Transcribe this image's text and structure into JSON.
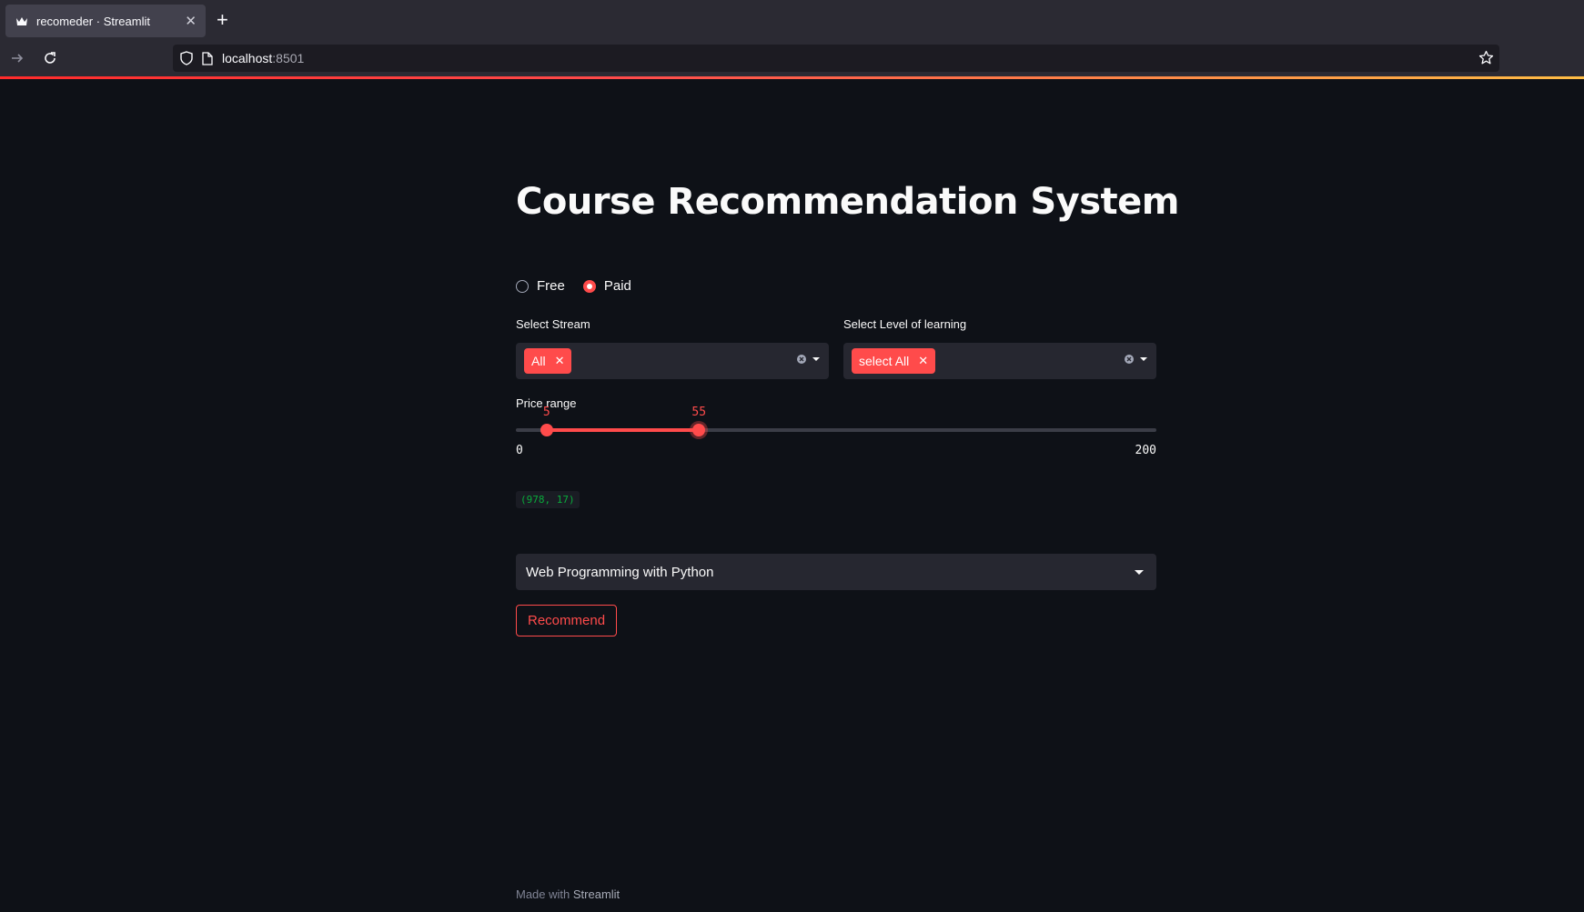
{
  "browser": {
    "tab_title": "recomeder · Streamlit",
    "url_host": "localhost",
    "url_port": ":8501",
    "icons": [
      "streamlit-crown-icon",
      "close-icon",
      "plus-icon",
      "forward-icon",
      "reload-icon",
      "shield-icon",
      "page-icon",
      "star-icon"
    ]
  },
  "app": {
    "title": "Course Recommendation System",
    "price_type": {
      "options": [
        "Free",
        "Paid"
      ],
      "selected": "Paid"
    },
    "stream": {
      "label": "Select Stream",
      "chips": [
        "All"
      ]
    },
    "level": {
      "label": "Select Level of learning",
      "chips": [
        "select All"
      ]
    },
    "price_range": {
      "label": "Price range",
      "min": 0,
      "max": 200,
      "low": 5,
      "high": 55,
      "min_label": "0",
      "max_label": "200",
      "low_label": "5",
      "high_label": "55"
    },
    "output_text": "(978, 17)",
    "course_select": {
      "value": "Web Programming with Python"
    },
    "recommend_label": "Recommend",
    "footer": {
      "prefix": "Made with",
      "brand": "Streamlit"
    }
  },
  "colors": {
    "accent": "#ff4b4b",
    "background": "#0e1117",
    "widget_bg": "#262730",
    "code_green": "#09ab3b"
  }
}
